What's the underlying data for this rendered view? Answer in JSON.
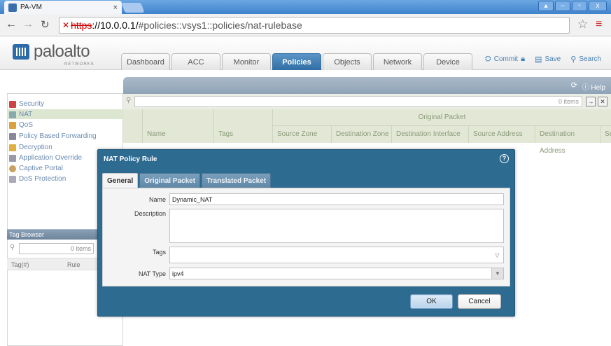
{
  "browser": {
    "tab_title": "PA-VM",
    "tab_close": "×",
    "url_scheme": "https",
    "url_host": "://10.0.0.1/",
    "url_path": "#policies::vsys1::policies/nat-rulebase",
    "window_buttons": [
      "–",
      "▫",
      "x"
    ]
  },
  "app": {
    "logo_word": "paloalto",
    "logo_sub": "NETWORKS",
    "tabs": [
      {
        "label": "Dashboard",
        "active": false
      },
      {
        "label": "ACC",
        "active": false
      },
      {
        "label": "Monitor",
        "active": false
      },
      {
        "label": "Policies",
        "active": true
      },
      {
        "label": "Objects",
        "active": false
      },
      {
        "label": "Network",
        "active": false
      },
      {
        "label": "Device",
        "active": false
      }
    ],
    "tools": {
      "commit": "Commit",
      "save": "Save",
      "search": "Search"
    }
  },
  "sidebar": {
    "items": [
      {
        "label": "Security",
        "icon": "security-icon"
      },
      {
        "label": "NAT",
        "icon": "nat-icon"
      },
      {
        "label": "QoS",
        "icon": "qos-icon"
      },
      {
        "label": "Policy Based Forwarding",
        "icon": "pbf-icon"
      },
      {
        "label": "Decryption",
        "icon": "decryption-icon"
      },
      {
        "label": "Application Override",
        "icon": "app-override-icon"
      },
      {
        "label": "Captive Portal",
        "icon": "captive-portal-icon"
      },
      {
        "label": "DoS Protection",
        "icon": "dos-icon"
      }
    ],
    "selected": "NAT"
  },
  "tag_browser": {
    "title": "Tag Browser",
    "search_count": "0 items",
    "columns": [
      "Tag(#)",
      "Rule"
    ]
  },
  "panel": {
    "help": "Help",
    "search_count": "0 items",
    "group_header": "Original Packet",
    "columns": [
      "Name",
      "Tags",
      "Source Zone",
      "Destination Zone",
      "Destination Interface",
      "Source Address",
      "Destination Address",
      "Se"
    ]
  },
  "dialog": {
    "title": "NAT Policy Rule",
    "tabs": [
      {
        "label": "General",
        "active": true
      },
      {
        "label": "Original Packet",
        "active": false
      },
      {
        "label": "Translated Packet",
        "active": false
      }
    ],
    "fields": {
      "name_label": "Name",
      "name_value": "Dynamic_NAT",
      "description_label": "Description",
      "description_value": "",
      "tags_label": "Tags",
      "tags_value": "",
      "nat_type_label": "NAT Type",
      "nat_type_value": "ipv4"
    },
    "ok_label": "OK",
    "cancel_label": "Cancel"
  }
}
